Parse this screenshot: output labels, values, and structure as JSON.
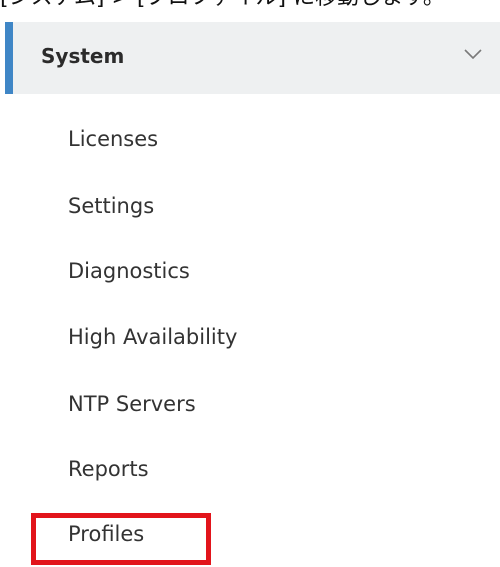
{
  "caption": "[システム] > [プロファイル] に移動します。",
  "section": {
    "title": "System",
    "expand_icon": "chevron-down-icon"
  },
  "menu": {
    "items": [
      {
        "label": "Licenses"
      },
      {
        "label": "Settings"
      },
      {
        "label": "Diagnostics"
      },
      {
        "label": "High Availability"
      },
      {
        "label": "NTP Servers"
      },
      {
        "label": "Reports"
      },
      {
        "label": "Profiles"
      }
    ]
  },
  "colors": {
    "accent": "#3f86c6",
    "highlight": "#e2141b",
    "header_bg": "#eef0f1"
  }
}
